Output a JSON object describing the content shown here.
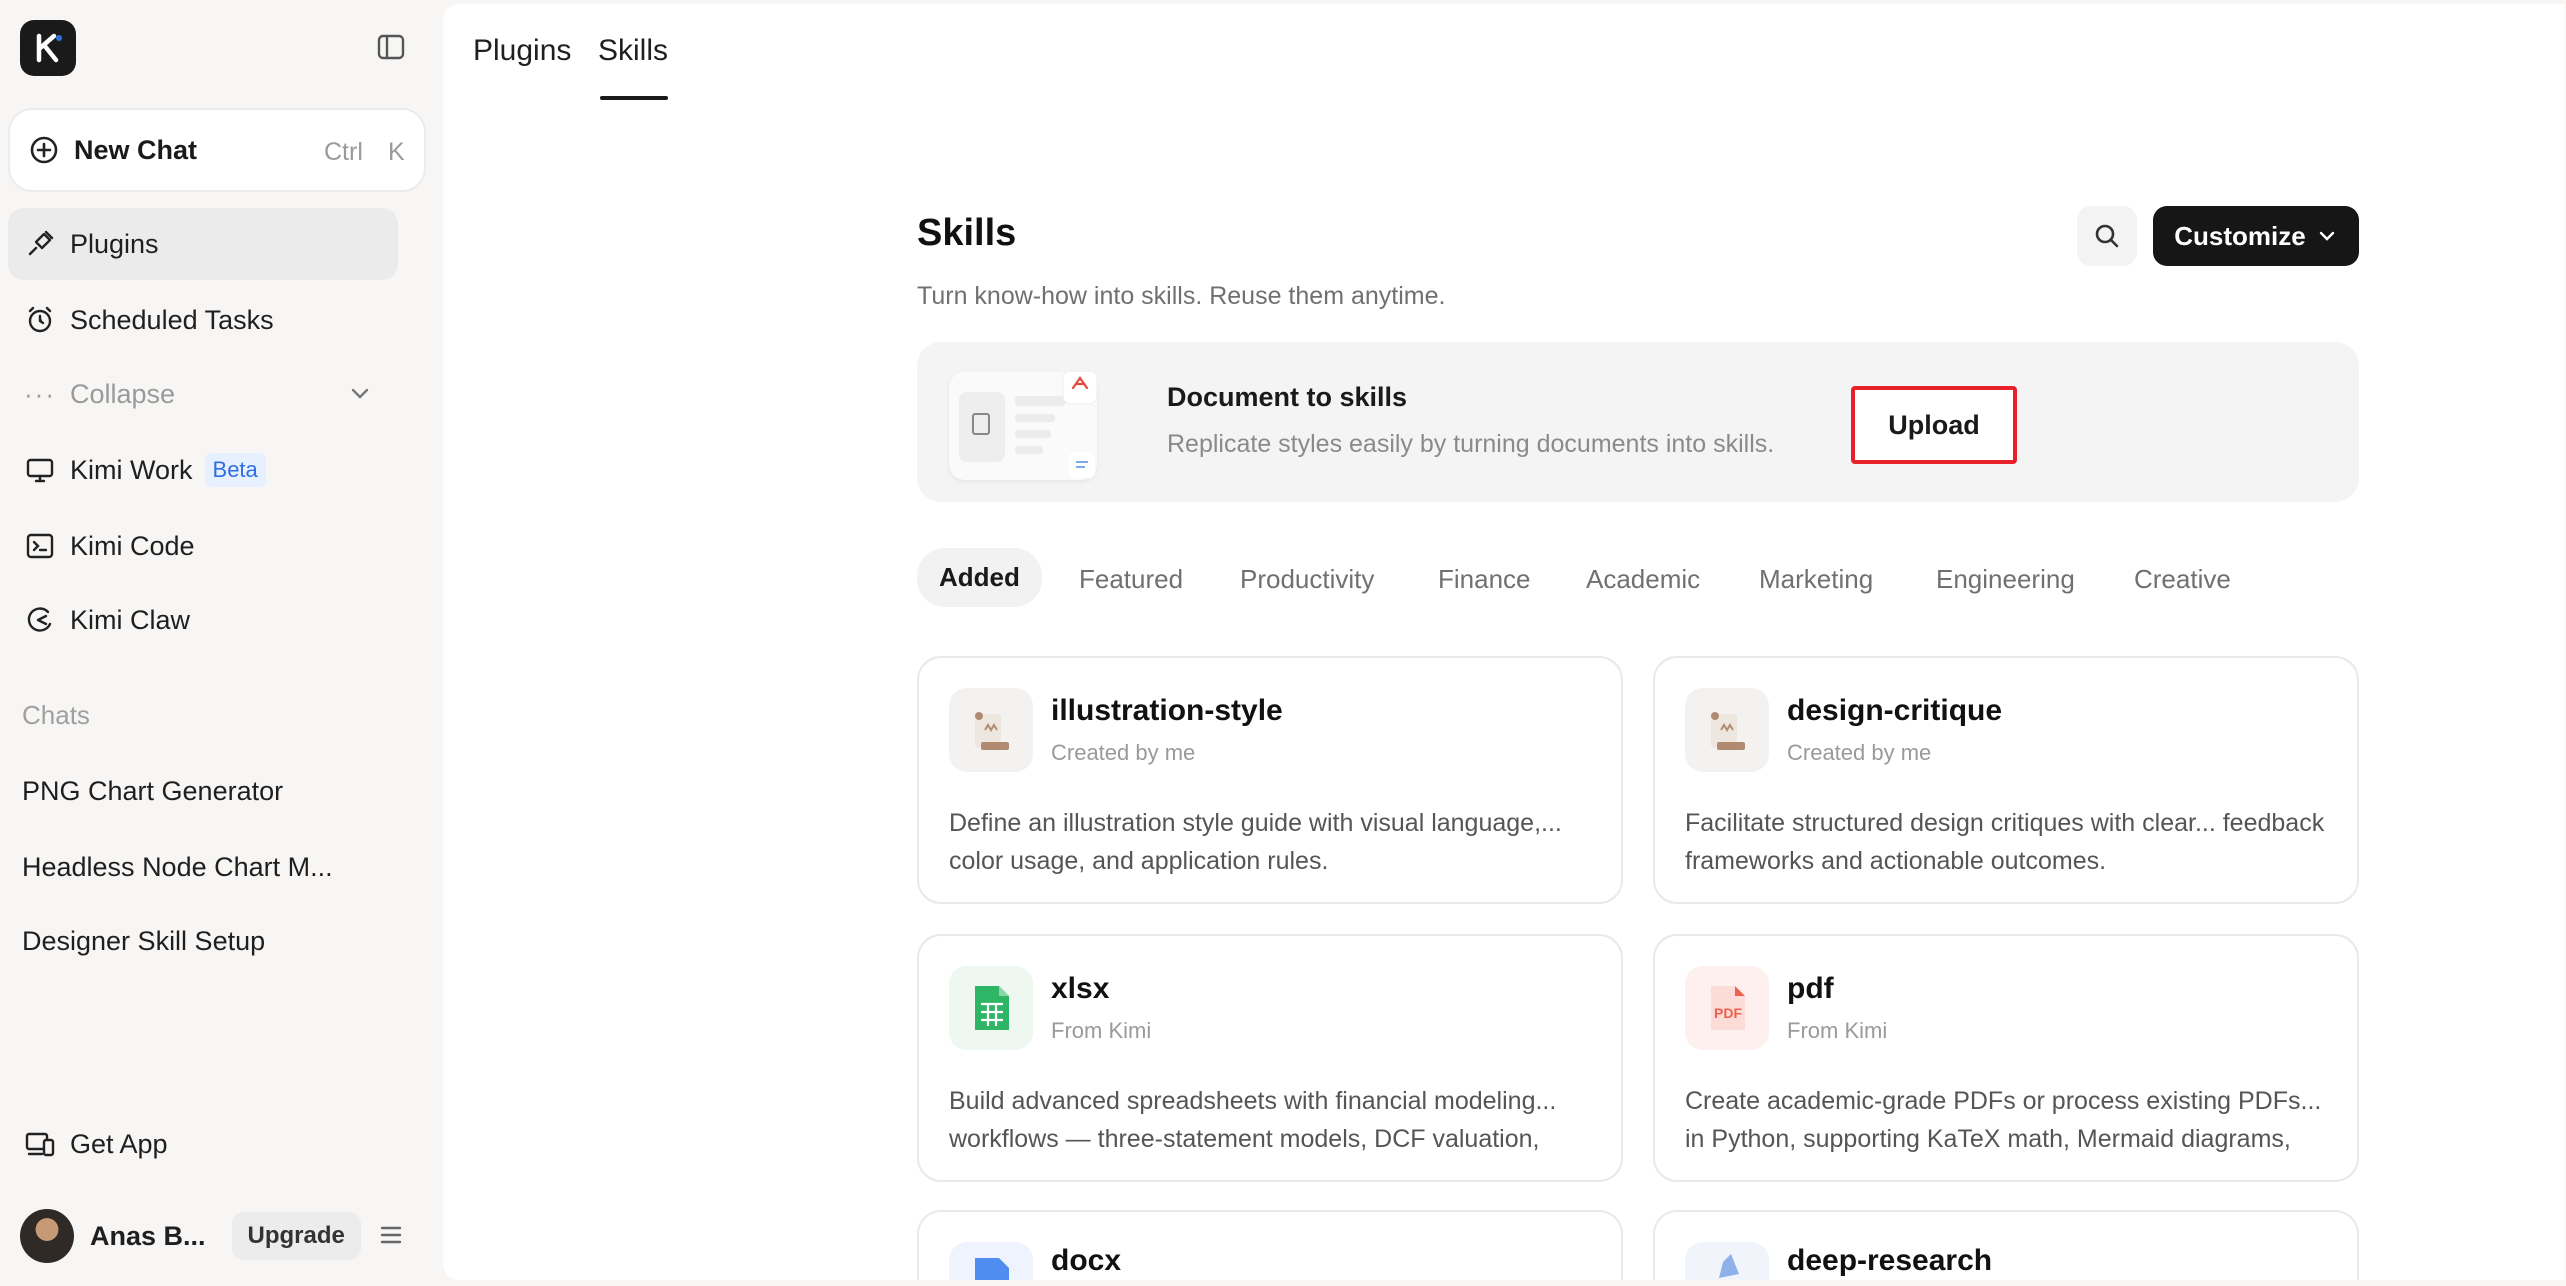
{
  "sidebar": {
    "logo": "K",
    "new_chat": {
      "label": "New Chat",
      "kbd1": "Ctrl",
      "kbd2": "K"
    },
    "items": [
      {
        "label": "Plugins",
        "icon": "plug-icon"
      },
      {
        "label": "Scheduled Tasks",
        "icon": "alarm-clock-icon"
      },
      {
        "label": "Collapse",
        "icon": "dots-icon"
      },
      {
        "label": "Kimi Work",
        "icon": "monitor-icon",
        "badge": "Beta"
      },
      {
        "label": "Kimi Code",
        "icon": "terminal-icon"
      },
      {
        "label": "Kimi Claw",
        "icon": "claw-icon"
      }
    ],
    "chats_label": "Chats",
    "chats": [
      "PNG Chart Generator",
      "Headless Node Chart M...",
      "Designer Skill Setup"
    ],
    "get_app": "Get App",
    "user": {
      "name": "Anas B...",
      "upgrade": "Upgrade"
    }
  },
  "tabs": [
    "Plugins",
    "Skills"
  ],
  "header": {
    "title": "Skills",
    "subtitle": "Turn know-how into skills. Reuse them anytime.",
    "customize": "Customize"
  },
  "banner": {
    "title": "Document to skills",
    "subtitle": "Replicate styles easily by turning documents into skills.",
    "button": "Upload"
  },
  "categories": [
    "Added",
    "Featured",
    "Productivity",
    "Finance",
    "Academic",
    "Marketing",
    "Engineering",
    "Creative"
  ],
  "cards": [
    {
      "title": "illustration-style",
      "meta": "Created by me",
      "desc": "Define an illustration style guide with visual language,... color usage, and application rules."
    },
    {
      "title": "design-critique",
      "meta": "Created by me",
      "desc": "Facilitate structured design critiques with clear... feedback frameworks and actionable outcomes."
    },
    {
      "title": "xlsx",
      "meta": "From Kimi",
      "desc": "Build advanced spreadsheets with financial modeling... workflows — three-statement models, DCF valuation,"
    },
    {
      "title": "pdf",
      "meta": "From Kimi",
      "desc": "Create academic-grade PDFs or process existing PDFs... in Python, supporting KaTeX math, Mermaid diagrams,"
    },
    {
      "title": "docx"
    },
    {
      "title": "deep-research"
    }
  ],
  "pdf_icon_text": "PDF",
  "colors": {
    "accent_dark": "#161616",
    "highlight_red": "#e8202a",
    "beta_blue": "#2f6fe4",
    "xlsx_green": "#2fb566",
    "pdf_red": "#f0604f"
  }
}
